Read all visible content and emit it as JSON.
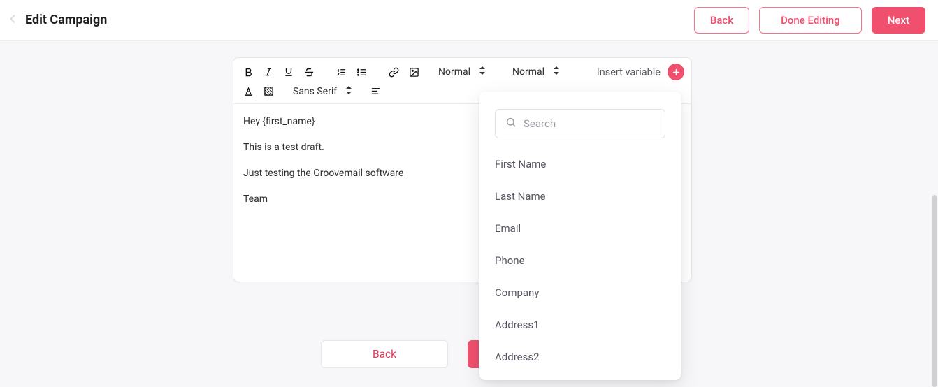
{
  "header": {
    "title": "Edit Campaign",
    "back_label": "Back",
    "done_label": "Done Editing",
    "next_label": "Next"
  },
  "toolbar": {
    "size_select": "Normal",
    "heading_select": "Normal",
    "insert_variable_label": "Insert variable",
    "font_select": "Sans Serif"
  },
  "editor": {
    "line1": "Hey {first_name}",
    "line2": "This is a test draft.",
    "line3": "Just testing the Groovemail software",
    "line4": "Team"
  },
  "bottom": {
    "back_label": "Back"
  },
  "dropdown": {
    "search_placeholder": "Search",
    "items": [
      "First Name",
      "Last Name",
      "Email",
      "Phone",
      "Company",
      "Address1",
      "Address2"
    ]
  }
}
